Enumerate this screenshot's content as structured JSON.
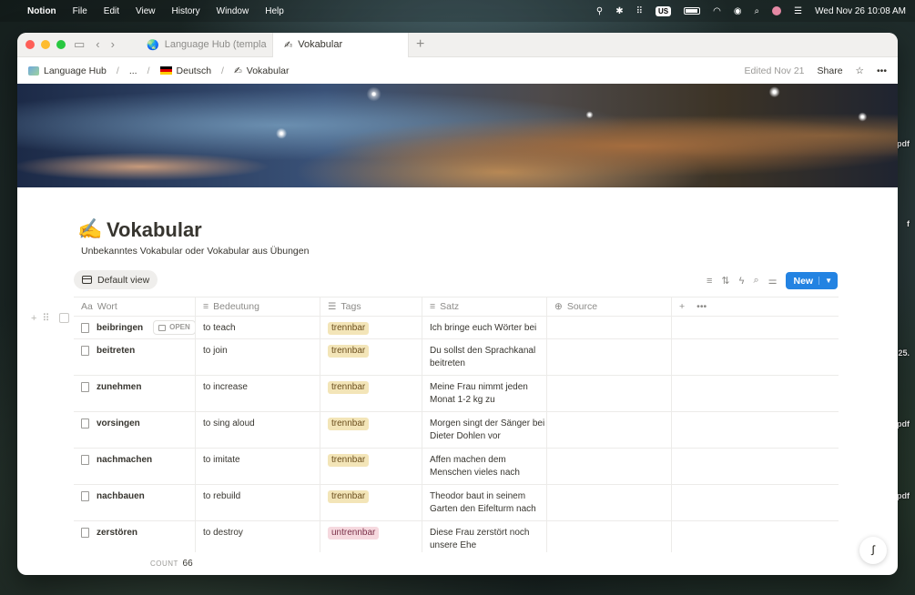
{
  "menubar": {
    "app_name": "Notion",
    "menus": [
      "File",
      "Edit",
      "View",
      "History",
      "Window",
      "Help"
    ],
    "keyboard_layout": "US",
    "clock": "Wed Nov 26  10:08 AM"
  },
  "desktop_labels": [
    "pdf",
    "f",
    "25.",
    "pdf",
    "pdf"
  ],
  "tabs": [
    {
      "label": "Language Hub (templa",
      "icon": "globe-icon",
      "active": false
    },
    {
      "label": "Vokabular",
      "icon": "writing-hand-icon",
      "active": true
    }
  ],
  "breadcrumb": {
    "items": [
      "Language Hub",
      "...",
      "Deutsch",
      "Vokabular"
    ],
    "edited": "Edited Nov 21",
    "share": "Share"
  },
  "page": {
    "icon": "✍️",
    "title": "Vokabular",
    "description": "Unbekanntes Vokabular oder Vokabular aus Übungen"
  },
  "view": {
    "label": "Default view"
  },
  "toolbar": {
    "new_label": "New"
  },
  "table": {
    "columns": [
      {
        "label": "Wort",
        "icon": "Aa"
      },
      {
        "label": "Bedeutung",
        "icon": "≡"
      },
      {
        "label": "Tags",
        "icon": "☰"
      },
      {
        "label": "Satz",
        "icon": "≡"
      },
      {
        "label": "Source",
        "icon": "⊕"
      }
    ],
    "open_label": "OPEN",
    "rows": [
      {
        "wort": "beibringen",
        "bedeutung": "to teach",
        "tag": "trennbar",
        "satz": "Ich bringe euch Wörter bei"
      },
      {
        "wort": "beitreten",
        "bedeutung": "to join",
        "tag": "trennbar",
        "satz": "Du sollst den Sprachkanal beitreten"
      },
      {
        "wort": "zunehmen",
        "bedeutung": "to increase",
        "tag": "trennbar",
        "satz": "Meine Frau nimmt jeden Monat 1-2 kg zu"
      },
      {
        "wort": "vorsingen",
        "bedeutung": "to sing aloud",
        "tag": "trennbar",
        "satz": "Morgen singt der Sänger bei Dieter Dohlen vor"
      },
      {
        "wort": "nachmachen",
        "bedeutung": "to imitate",
        "tag": "trennbar",
        "satz": "Affen machen dem Menschen vieles nach"
      },
      {
        "wort": "nachbauen",
        "bedeutung": "to rebuild",
        "tag": "trennbar",
        "satz": "Theodor baut in seinem Garten den Eifelturm nach"
      },
      {
        "wort": "zerstören",
        "bedeutung": "to destroy",
        "tag": "untrennbar",
        "satz": "Diese Frau zerstört noch unsere Ehe"
      }
    ],
    "count_label": "COUNT",
    "count_value": "66"
  },
  "colors": {
    "accent": "#2383e2",
    "tag_trennbar": "#f3e5b8",
    "tag_untrennbar": "#f6d9df"
  }
}
